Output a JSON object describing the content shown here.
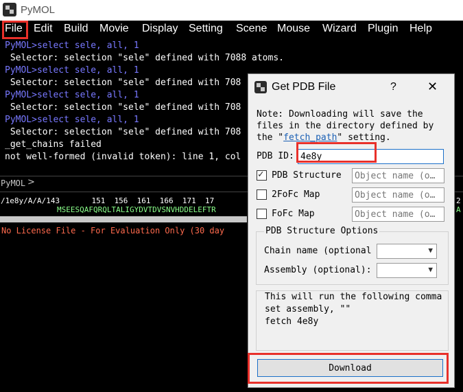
{
  "app": {
    "title": "PyMOL"
  },
  "menu": [
    "File",
    "Edit",
    "Build",
    "Movie",
    "Display",
    "Setting",
    "Scene",
    "Mouse",
    "Wizard",
    "Plugin",
    "Help"
  ],
  "console": {
    "lines": [
      {
        "kind": "prompt",
        "text": "PyMOL>select sele, all, 1"
      },
      {
        "kind": "out",
        "text": " Selector: selection \"sele\" defined with 7088 atoms."
      },
      {
        "kind": "prompt",
        "text": "PyMOL>select sele, all, 1"
      },
      {
        "kind": "out",
        "text": " Selector: selection \"sele\" defined with 708"
      },
      {
        "kind": "prompt",
        "text": "PyMOL>select sele, all, 1"
      },
      {
        "kind": "out",
        "text": " Selector: selection \"sele\" defined with 708"
      },
      {
        "kind": "prompt",
        "text": "PyMOL>select sele, all, 1"
      },
      {
        "kind": "out",
        "text": " Selector: selection \"sele\" defined with 708"
      },
      {
        "kind": "out",
        "text": "_get_chains failed"
      },
      {
        "kind": "out",
        "text": "not well-formed (invalid token): line 1, col"
      }
    ],
    "command_label": "PyMOL",
    "command_chevron": ">"
  },
  "sequence": {
    "numbers_line": "/1e8y/A/A/143       151  156  161  166  171  17",
    "residues_line": "MSEESQAFQRQLTALIGYDVTDVSNVHDDELEFTR",
    "right_number": "2",
    "right_residue": "A"
  },
  "license_text": "No License File - For Evaluation Only (30 day",
  "dialog": {
    "title": "Get PDB File",
    "help": "?",
    "close": "✕",
    "note_line1": "Note: Downloading will save the",
    "note_line2": "files in the directory defined by",
    "note_pre": "the \"",
    "note_link": "fetch_path",
    "note_post": "\" setting.",
    "pdb_id_label": "PDB ID:",
    "pdb_id_value": "4e8y",
    "pdb_structure": {
      "label": "PDB Structure",
      "checked": true
    },
    "twofofc": {
      "label": "2FoFc Map",
      "checked": false
    },
    "fofc": {
      "label": "FoFc Map",
      "checked": false
    },
    "object_placeholder": "Object name (o…",
    "options_title": "PDB Structure Options",
    "chain_label": "Chain name (optional",
    "assembly_label": "Assembly (optional):",
    "info_text": "This will run the following comma\nset assembly, \"\"\nfetch 4e8y",
    "download_label": "Download"
  },
  "colors": {
    "highlight_red": "#e8302a",
    "prompt_blue": "#7878ff",
    "sequence_green": "#8aff8a",
    "license_red": "#ff6a4d"
  },
  "icons": [
    "pymol-logo-icon",
    "help-icon",
    "close-icon",
    "checkmark-icon",
    "chevron-down-icon"
  ]
}
